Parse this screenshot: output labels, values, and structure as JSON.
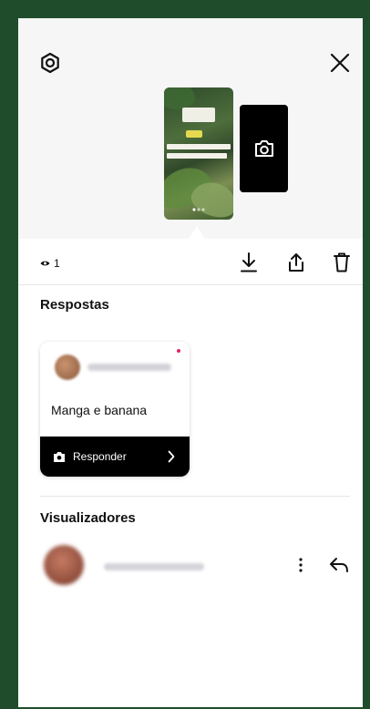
{
  "viewer_count": "1",
  "sections": {
    "replies_title": "Respostas",
    "viewers_title": "Visualizadores"
  },
  "reply": {
    "text": "Manga e banana",
    "action_label": "Responder"
  },
  "icons": {
    "settings": "settings-icon",
    "close": "close-icon",
    "camera": "camera-icon",
    "eye": "eye-icon",
    "download": "download-icon",
    "share": "share-icon",
    "delete": "trash-icon",
    "chevron": "chevron-right-icon",
    "more": "more-vertical-icon",
    "reply": "reply-arrow-icon"
  },
  "colors": {
    "frame": "#1f4d2b",
    "action_bar": "#000000",
    "unread_dot": "#e0245e"
  }
}
